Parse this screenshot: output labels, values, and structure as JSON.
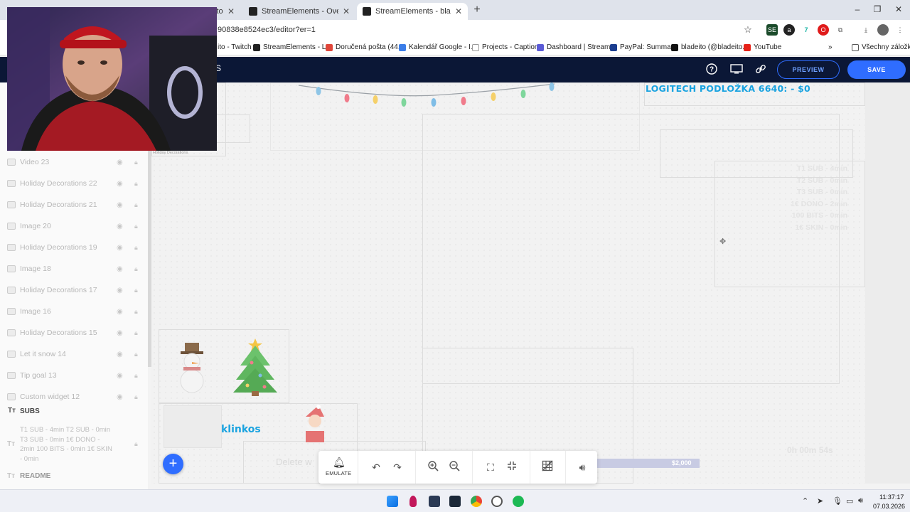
{
  "browser": {
    "tabs": [
      {
        "label": "ito - Twitch",
        "active": false
      },
      {
        "label": "StreamElements - Overlays",
        "active": false
      },
      {
        "label": "StreamElements - bladeito",
        "active": true
      }
    ],
    "url": "90838e8524ec3/editor?er=1",
    "bookmarks": [
      "ito - Twitch",
      "StreamElements - L...",
      "Doručená pošta (44...",
      "Kalendář Google - I...",
      "Projects - Captions",
      "Dashboard | Stream...",
      "PayPal: Summary",
      "bladeito (@bladeito...",
      "YouTube"
    ],
    "bookmarks_folder": "Všechny záložky"
  },
  "header": {
    "logo_fragment": "S",
    "preview_label": "PREVIEW",
    "save_label": "SAVE"
  },
  "layers": [
    {
      "name": "Video 23"
    },
    {
      "name": "Holiday Decorations 22"
    },
    {
      "name": "Holiday Decorations 21"
    },
    {
      "name": "Image 20"
    },
    {
      "name": "Holiday Decorations 19"
    },
    {
      "name": "Image 18"
    },
    {
      "name": "Holiday Decorations 17"
    },
    {
      "name": "Image 16"
    },
    {
      "name": "Holiday Decorations 15"
    },
    {
      "name": "Let it snow 14"
    },
    {
      "name": "Tip goal 13"
    },
    {
      "name": "Custom widget 12"
    }
  ],
  "layer_group": {
    "type_icon": "Tт",
    "name": "SUBS"
  },
  "subs_layer_text": "T1 SUB - 4min T2 SUB - 0min T3 SUB - 0min 1€ DONO - 2min 100 BITS - 0min 1€ SKIN - 0min",
  "readme_label": "README",
  "canvas": {
    "logitech_text": "LOGITECH PODLOŽKA 6640:  - $0",
    "tip_goal_value": "$2,000",
    "klinkos_text": "klinkos",
    "holiday_label": "Holiday Decorations",
    "right_list": [
      "T1 SUB - 4min",
      "T2 SUB - 0min",
      "T3 SUB - 0min",
      "1€ DONO - 2min",
      "100 BITS - 0min",
      "1€ SKIN - 0min"
    ],
    "ghost_delete": "Delete w",
    "timer_ghost": "0h 00m 54s"
  },
  "toolbar": {
    "emulate_label": "EMULATE"
  },
  "taskbar": {
    "time": "11:37:17",
    "date": "07.03.2026"
  },
  "colors": {
    "header_bg": "#0b1736",
    "accent": "#2f6dff",
    "logitech_text": "#1aa3e0"
  }
}
